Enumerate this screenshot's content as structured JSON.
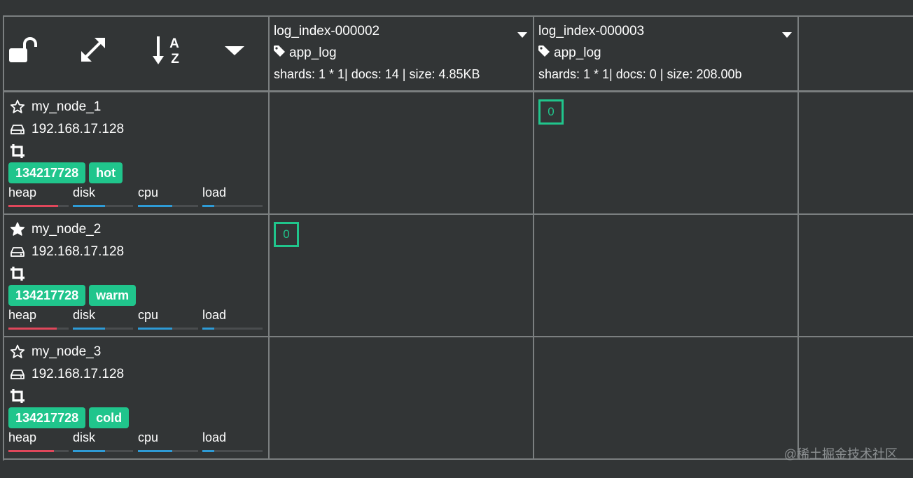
{
  "toolbar": {
    "icons": [
      "unlock-icon",
      "expand-icon",
      "sort-alpha-icon",
      "caret-down-icon"
    ]
  },
  "indices": [
    {
      "name": "log_index-000002",
      "alias": "app_log",
      "stats": "shards: 1 * 1| docs: 14 | size: 4.85KB"
    },
    {
      "name": "log_index-000003",
      "alias": "app_log",
      "stats": "shards: 1 * 1| docs: 0 | size: 208.00b"
    }
  ],
  "nodes": [
    {
      "name": "my_node_1",
      "ip": "192.168.17.128",
      "master": false,
      "badges": [
        "134217728",
        "hot"
      ],
      "metrics": {
        "heap": 0.82,
        "disk": 0.53,
        "cpu": 0.57,
        "load": 0.2
      }
    },
    {
      "name": "my_node_2",
      "ip": "192.168.17.128",
      "master": true,
      "badges": [
        "134217728",
        "warm"
      ],
      "metrics": {
        "heap": 0.8,
        "disk": 0.53,
        "cpu": 0.57,
        "load": 0.2
      }
    },
    {
      "name": "my_node_3",
      "ip": "192.168.17.128",
      "master": false,
      "badges": [
        "134217728",
        "cold"
      ],
      "metrics": {
        "heap": 0.75,
        "disk": 0.53,
        "cpu": 0.57,
        "load": 0.2
      }
    }
  ],
  "metric_labels": [
    "heap",
    "disk",
    "cpu",
    "load"
  ],
  "metric_colors": {
    "heap": "#e0475b",
    "disk": "#2e9bd6",
    "cpu": "#2e9bd6",
    "load": "#2e9bd6"
  },
  "shards": [
    {
      "node": 0,
      "index": 1,
      "label": "0"
    },
    {
      "node": 1,
      "index": 0,
      "label": "0"
    }
  ],
  "watermark": "@稀土掘金技术社区"
}
